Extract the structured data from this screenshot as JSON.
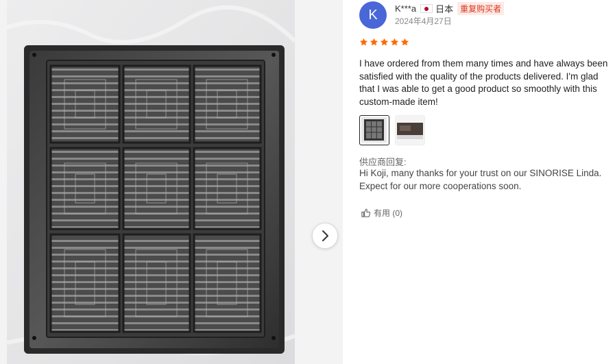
{
  "reviewer": {
    "initial": "K",
    "name": "K***a",
    "country": "日本",
    "badge": "重复购买者",
    "date": "2024年4月27日",
    "rating": 5
  },
  "review": {
    "text": "I have ordered from them many times and have always been satisfied with the quality of the products delivered. I'm glad that I was able to get a good product so smoothly with this custom-made item!"
  },
  "supplier_reply": {
    "label": "供应商回复:",
    "text": "Hi Koji, many thanks for your trust on our SINORISE Linda. Expect for our more cooperations soon."
  },
  "helpful": {
    "label": "有用 (0)"
  },
  "colors": {
    "avatar": "#4a67d8",
    "star": "#ff6a00",
    "badge_text": "#d9381e",
    "badge_bg": "#fde9e5"
  },
  "icons": [
    "chevron-right-icon",
    "star-icon",
    "japan-flag-icon",
    "thumbs-up-icon"
  ]
}
